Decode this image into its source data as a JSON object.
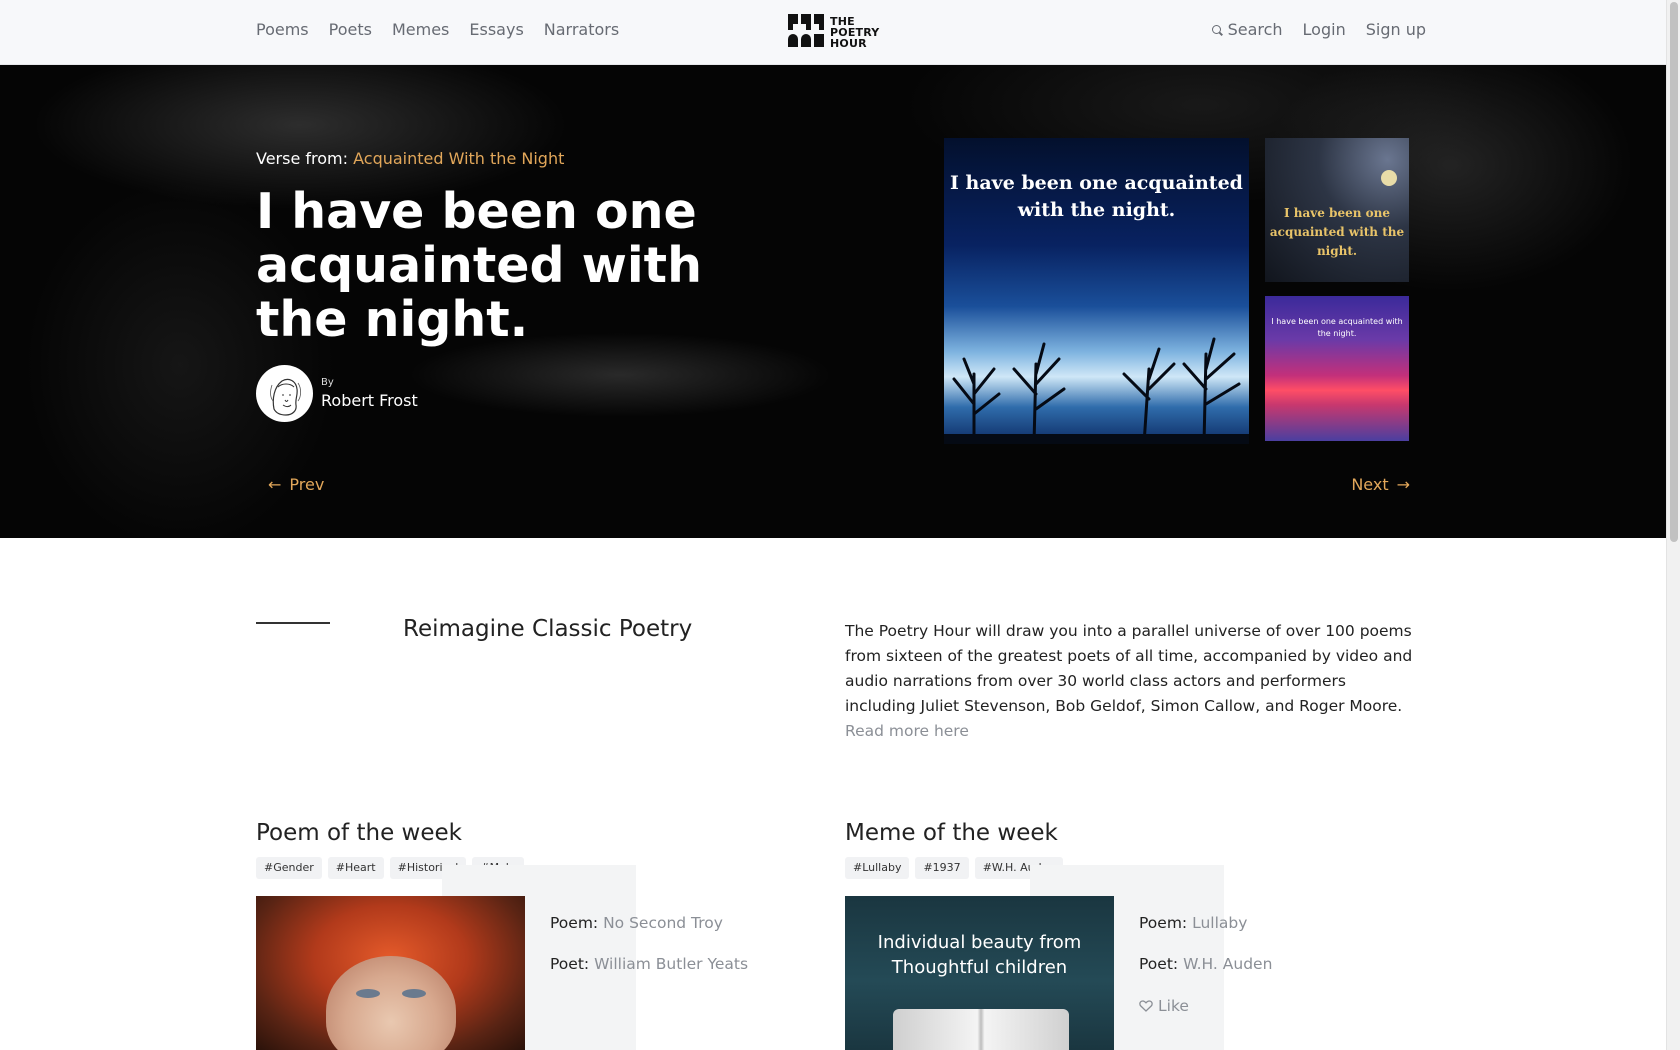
{
  "nav": {
    "links": [
      "Poems",
      "Poets",
      "Memes",
      "Essays",
      "Narrators"
    ],
    "logo_lines": [
      "THE",
      "POETRY",
      "HOUR"
    ],
    "search": "Search",
    "login": "Login",
    "signup": "Sign up"
  },
  "hero": {
    "verse_from_label": "Verse from:",
    "verse_from_title": "Acquainted With the Night",
    "title": "I have been one acquainted with the night.",
    "by": "By",
    "author": "Robert Frost",
    "prev": "Prev",
    "next": "Next",
    "meme_big_caption": "I have been one acquainted with the night.",
    "meme_small1_caption": "I have been one acquainted with the night.",
    "meme_small2_caption": "I have been one acquainted with the night."
  },
  "about": {
    "title": "Reimagine Classic Poetry",
    "text": "The Poetry Hour will draw you into a parallel universe of over 100 poems from sixteen of the greatest poets of all time, accompanied by video and audio narrations from over 30 world class actors and performers including Juliet Stevenson, Bob Geldof, Simon Callow, and Roger Moore.",
    "read_more": "Read more here"
  },
  "poem_week": {
    "title": "Poem of the week",
    "tags": [
      "#Gender",
      "#Heart",
      "#Historical",
      "#Male"
    ],
    "poem_label": "Poem:",
    "poem": "No Second Troy",
    "poet_label": "Poet:",
    "poet": "William Butler Yeats"
  },
  "meme_week": {
    "title": "Meme of the week",
    "tags": [
      "#Lullaby",
      "#1937",
      "#W.H. Auden"
    ],
    "image_caption": "Individual beauty from Thoughtful children",
    "poem_label": "Poem:",
    "poem": "Lullaby",
    "poet_label": "Poet:",
    "poet": "W.H. Auden",
    "like": "Like"
  },
  "colors": {
    "accent": "#e2a75a",
    "muted": "#8b8f96",
    "nav_bg": "#f7f8fa"
  }
}
